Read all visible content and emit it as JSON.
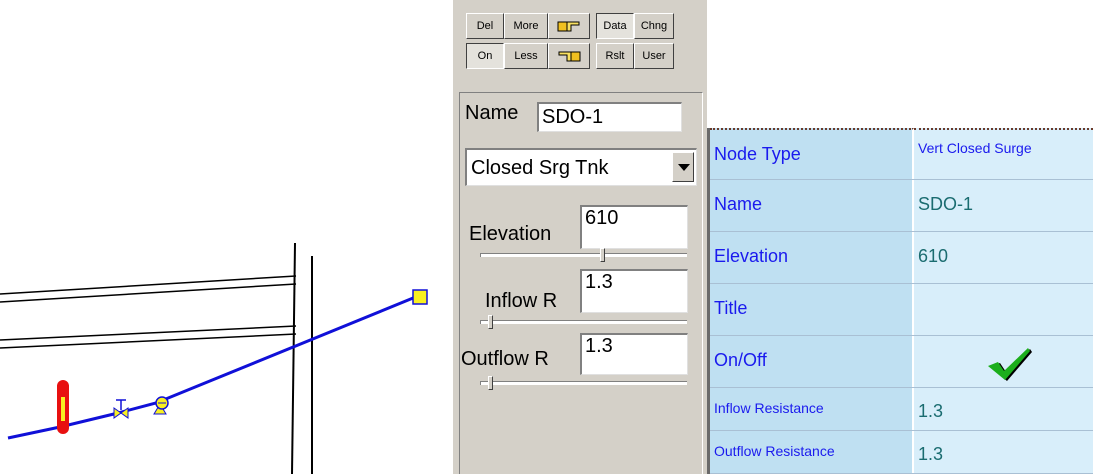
{
  "toolbar": {
    "row1": [
      {
        "label": "Del"
      },
      {
        "label": "More"
      },
      {
        "icon": "pointing-hand-right-icon"
      },
      {
        "label": "Data"
      },
      {
        "label": "Chng"
      }
    ],
    "row2": [
      {
        "label": "On"
      },
      {
        "label": "Less"
      },
      {
        "icon": "pointing-hand-left-icon"
      },
      {
        "label": "Rslt"
      },
      {
        "label": "User"
      }
    ]
  },
  "panel": {
    "name_label": "Name",
    "name_value": "SDO-1",
    "node_type_selected": "Closed Srg Tnk",
    "elevation_label": "Elevation",
    "elevation_value": "610",
    "inflow_label": "Inflow R",
    "inflow_value": "1.3",
    "outflow_label": "Outflow R",
    "outflow_value": "1.3"
  },
  "properties": {
    "rows": [
      {
        "key": "Node Type",
        "value": "Vert Closed Surge"
      },
      {
        "key": "Name",
        "value": "SDO-1"
      },
      {
        "key": "Elevation",
        "value": "610"
      },
      {
        "key": "Title",
        "value": ""
      },
      {
        "key": "On/Off",
        "value": ""
      },
      {
        "key": "Inflow Resistance",
        "value": "1.3"
      },
      {
        "key": "Outflow Resistance",
        "value": "1.3"
      }
    ]
  },
  "colors": {
    "pipe": "#1010d8",
    "tank_red": "#e81010",
    "node_yellow": "#f8f020",
    "grid_key_bg": "#bfe0f2",
    "grid_value_bg": "#d8eefa",
    "grid_key_text": "#1a1aee",
    "grid_value_text": "#1a6c70",
    "check_green": "#1cae1c"
  }
}
